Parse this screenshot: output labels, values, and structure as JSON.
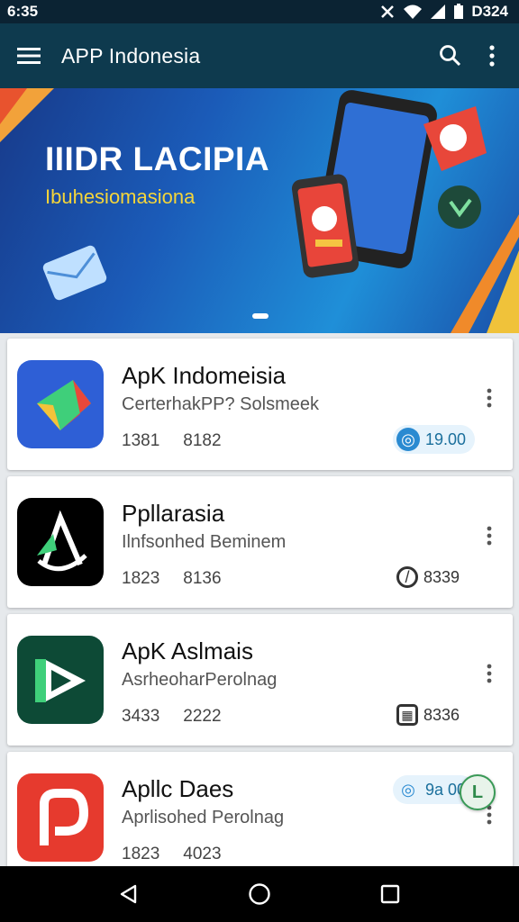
{
  "status_bar": {
    "time": "6:35",
    "battery_text": "D324"
  },
  "app_bar": {
    "title": "APP Indonesia",
    "icons": [
      "menu-icon",
      "search-icon",
      "more-vert-icon"
    ]
  },
  "banner": {
    "title": "IIIDR LACIPIA",
    "subtitle": "Ibuhesiomasiona"
  },
  "apps": [
    {
      "name": "ApK Indomeisia",
      "description": "CerterhakPP? Solsmeek",
      "stat1": "1381",
      "stat2": "8182",
      "badge": "19.00",
      "badge_color": "#2a8ad1",
      "icon_bg": "#2e5fd6"
    },
    {
      "name": "Ppllarasia",
      "description": "Ilnfsonhed Beminem",
      "stat1": "1823",
      "stat2": "8136",
      "badge": "8339",
      "badge_color": "#333333",
      "icon_bg": "#000000"
    },
    {
      "name": "ApK Aslmais",
      "description": "AsrheoharPerolnag",
      "stat1": "3433",
      "stat2": "2222",
      "badge": "8336",
      "badge_color": "#333333",
      "icon_bg": "#0d4a36"
    },
    {
      "name": "Apllc Daes",
      "description": "Aprlisohed Perolnag",
      "stat1": "1823",
      "stat2": "4023",
      "badge": "9a 00",
      "badge_color": "#2a8ad1",
      "icon_bg": "#e63a2e"
    }
  ],
  "fab": {
    "label": "L"
  },
  "nav": [
    "back-icon",
    "home-icon",
    "recents-icon"
  ]
}
